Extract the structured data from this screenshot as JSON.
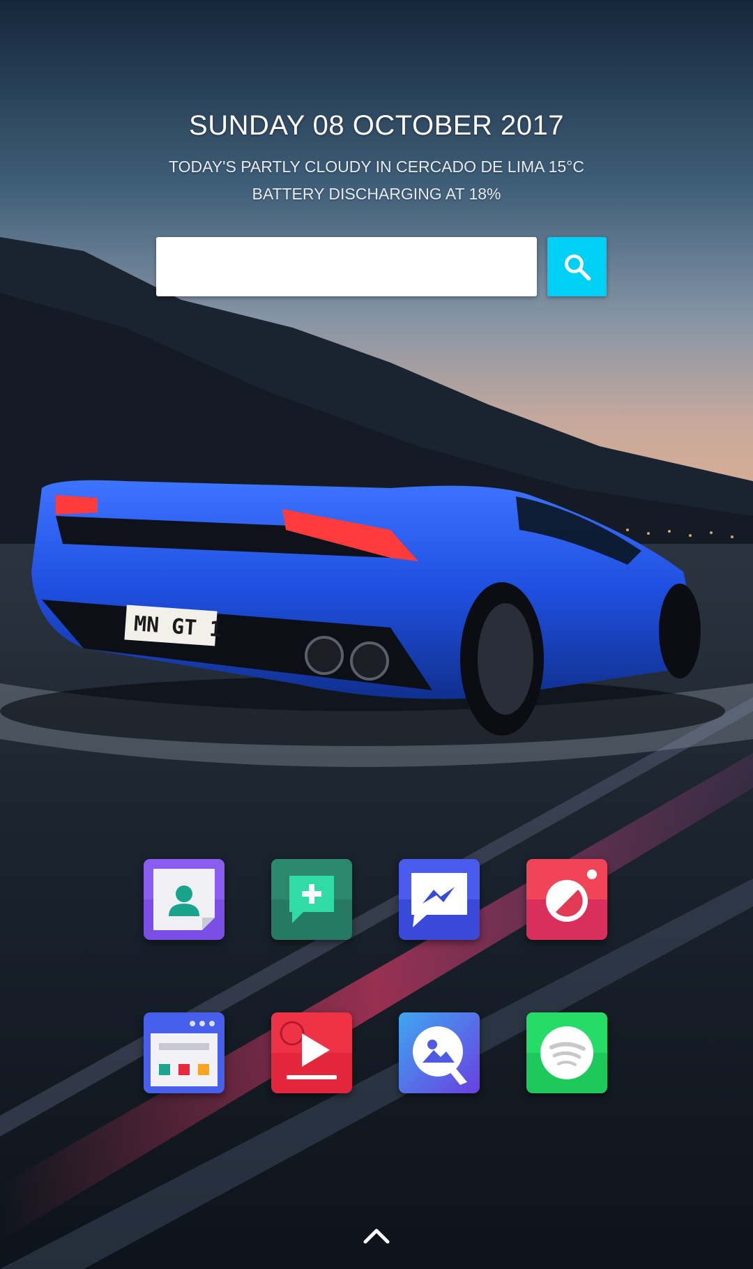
{
  "clock": {
    "date": "SUNDAY 08 OCTOBER 2017",
    "weather": "TODAY'S PARTLY CLOUDY IN CERCADO DE LIMA 15°C",
    "battery": "BATTERY DISCHARGING AT 18%"
  },
  "search": {
    "value": "",
    "placeholder": "",
    "button_icon": "search-icon",
    "button_color": "#00d0f5"
  },
  "wallpaper": {
    "license_plate": "MN GT 1"
  },
  "apps": [
    {
      "name": "contacts",
      "icon": "contacts-icon",
      "color": "#7b4fe6"
    },
    {
      "name": "new-message",
      "icon": "message-add-icon",
      "color": "#2f8f72"
    },
    {
      "name": "messenger",
      "icon": "messenger-icon",
      "color": "#4556e8"
    },
    {
      "name": "camera",
      "icon": "camera-icon",
      "color": "#e83a55"
    },
    {
      "name": "browser",
      "icon": "browser-icon",
      "color": "#4f66f0"
    },
    {
      "name": "video-player",
      "icon": "play-icon",
      "color": "#e32a3d"
    },
    {
      "name": "gallery",
      "icon": "gallery-icon",
      "color": "#5a54e6"
    },
    {
      "name": "spotify",
      "icon": "spotify-icon",
      "color": "#1ed85e"
    }
  ],
  "dock": {
    "drawer_icon": "chevron-up-icon"
  }
}
